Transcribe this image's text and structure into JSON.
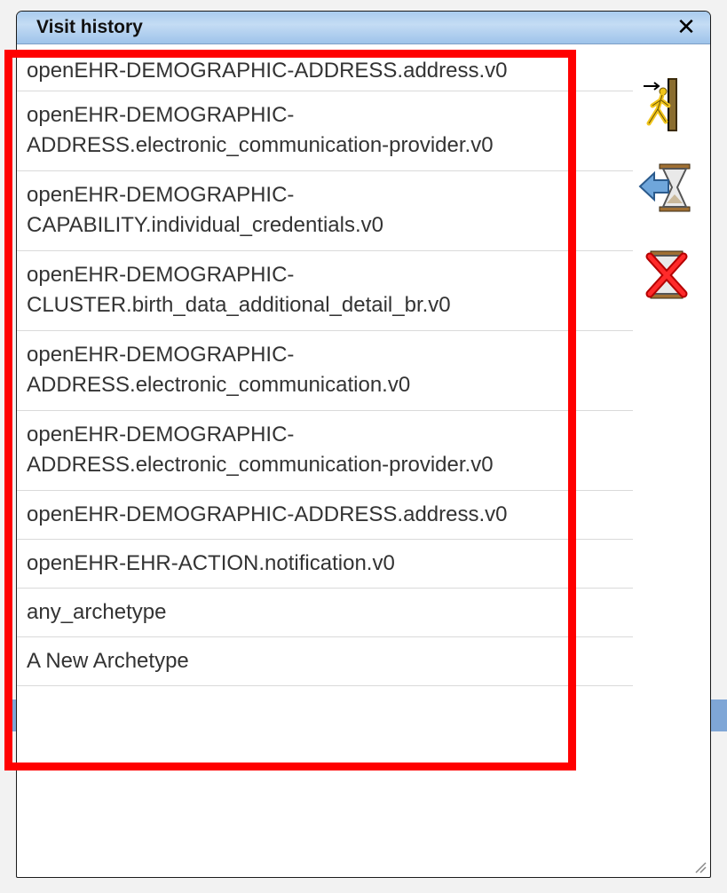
{
  "window": {
    "title": "Visit history",
    "close_glyph": "✕"
  },
  "history": [
    {
      "label": "openEHR-DEMOGRAPHIC-ADDRESS.address.v0"
    },
    {
      "label": "openEHR-DEMOGRAPHIC-\nADDRESS.electronic_communication-provider.v0"
    },
    {
      "label": "openEHR-DEMOGRAPHIC-\nCAPABILITY.individual_credentials.v0"
    },
    {
      "label": "openEHR-DEMOGRAPHIC-\nCLUSTER.birth_data_additional_detail_br.v0"
    },
    {
      "label": "openEHR-DEMOGRAPHIC-\nADDRESS.electronic_communication.v0"
    },
    {
      "label": "openEHR-DEMOGRAPHIC-\nADDRESS.electronic_communication-provider.v0"
    },
    {
      "label": "openEHR-DEMOGRAPHIC-ADDRESS.address.v0"
    },
    {
      "label": "openEHR-EHR-ACTION.notification.v0"
    },
    {
      "label": "any_archetype"
    },
    {
      "label": "A New Archetype"
    }
  ],
  "tools": [
    {
      "icon": "go-to-entry-icon"
    },
    {
      "icon": "back-history-icon"
    },
    {
      "icon": "clear-history-icon"
    }
  ],
  "colors": {
    "highlight": "#ff0000",
    "titlebar": "#a9cbee",
    "text": "#333333"
  }
}
